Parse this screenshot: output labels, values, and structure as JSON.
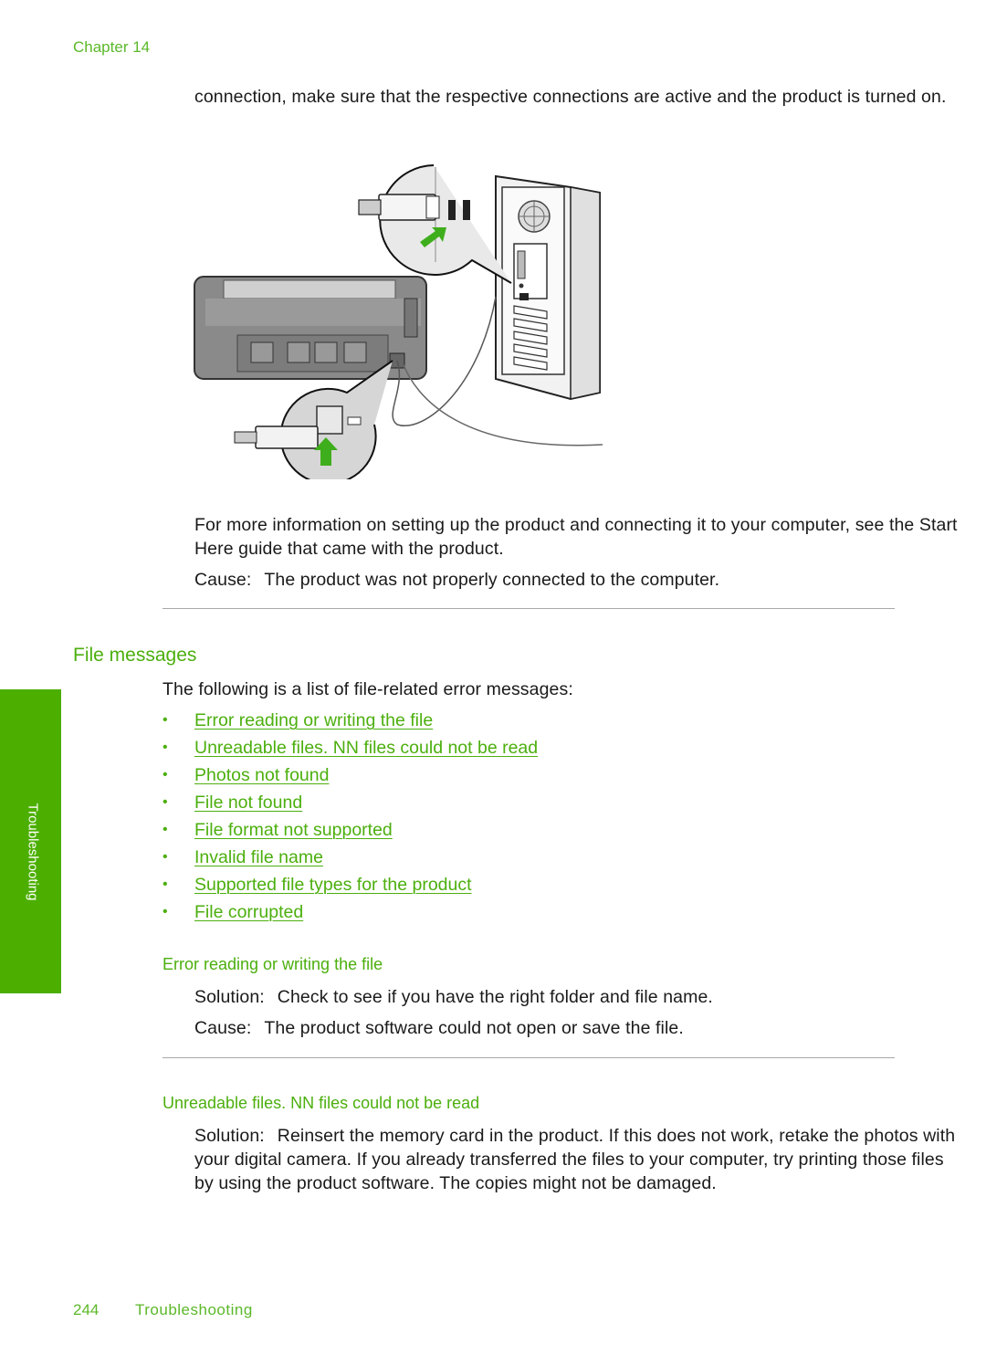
{
  "header": {
    "chapter": "Chapter 14"
  },
  "intro": {
    "text": "connection, make sure that the respective connections are active and the product is turned on."
  },
  "illustration": {
    "description": "Printer rear USB port connected by cable to computer rear USB port",
    "accent_color": "#3fae1c"
  },
  "more_info": {
    "text": "For more information on setting up the product and connecting it to your computer, see the Start Here guide that came with the product."
  },
  "cause_1": {
    "label": "Cause:",
    "text": "The product was not properly connected to the computer."
  },
  "file_messages": {
    "heading": "File messages",
    "intro": "The following is a list of file-related error messages:",
    "bullet": "•",
    "links": [
      "Error reading or writing the file",
      "Unreadable files. NN files could not be read",
      "Photos not found",
      "File not found",
      "File format not supported",
      "Invalid file name",
      "Supported file types for the product",
      "File corrupted"
    ]
  },
  "section_error_rw": {
    "heading": "Error reading or writing the file",
    "solution_label": "Solution:",
    "solution_text": "Check to see if you have the right folder and file name.",
    "cause_label": "Cause:",
    "cause_text": "The product software could not open or save the file."
  },
  "section_unreadable": {
    "heading": "Unreadable files. NN files could not be read",
    "solution_label": "Solution:",
    "solution_text": "Reinsert the memory card in the product. If this does not work, retake the photos with your digital camera. If you already transferred the files to your computer, try printing those files by using the product software. The copies might not be damaged."
  },
  "side_tab": {
    "label": "Troubleshooting",
    "color": "#4caf00"
  },
  "footer": {
    "page_number": "244",
    "section": "Troubleshooting"
  }
}
